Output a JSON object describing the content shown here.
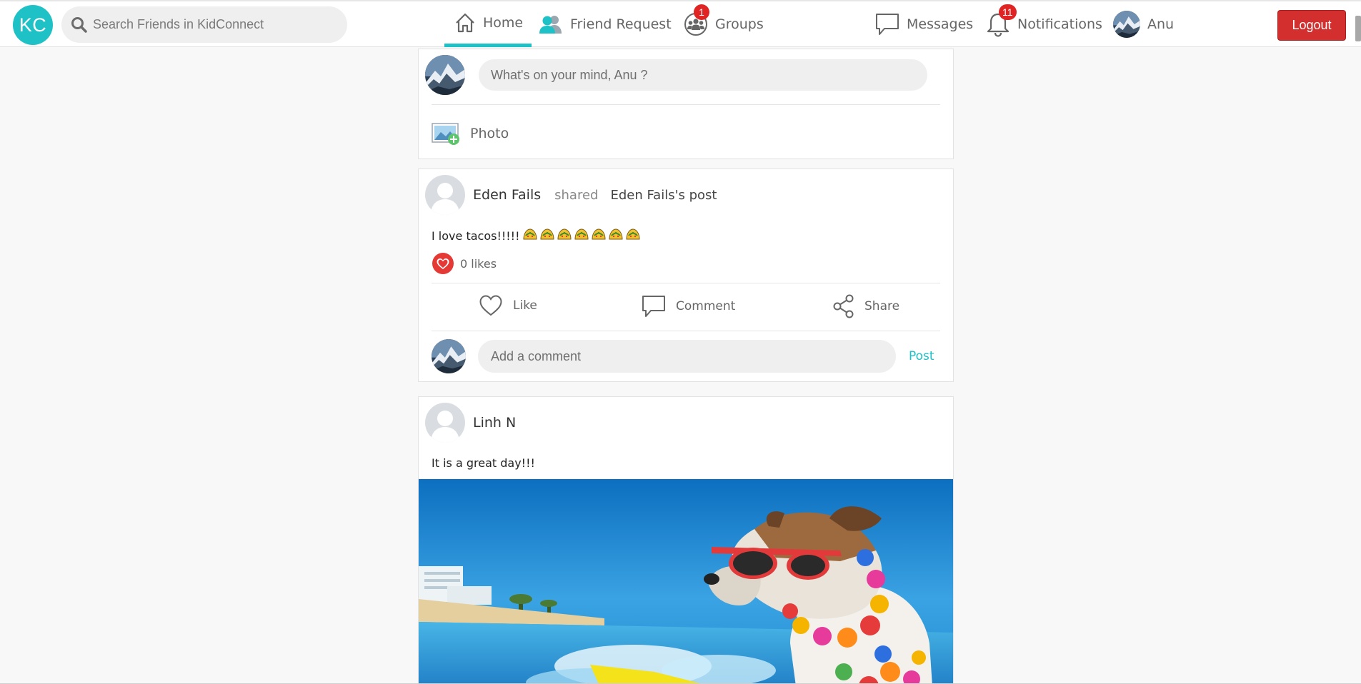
{
  "navbar": {
    "logo": "KC",
    "search_placeholder": "Search Friends in KidConnect",
    "home": "Home",
    "friend_request": "Friend Request",
    "groups": "Groups",
    "groups_badge": "1",
    "messages": "Messages",
    "notifications": "Notifications",
    "notifications_badge": "11",
    "user_name": "Anu",
    "logout": "Logout"
  },
  "composer": {
    "placeholder": "What's on your mind, Anu ?",
    "photo_label": "Photo"
  },
  "posts": [
    {
      "author": "Eden Fails",
      "action": "shared",
      "source": "Eden Fails's post",
      "text": "I love tacos!!!!!",
      "emoji_count": 7,
      "likes": "0 likes",
      "like_label": "Like",
      "comment_label": "Comment",
      "share_label": "Share",
      "comment_placeholder": "Add a comment",
      "post_label": "Post"
    },
    {
      "author": "Linh N",
      "text": "It is a great day!!!",
      "image": "dog-surfing-photo"
    }
  ],
  "colors": {
    "accent": "#1ec1c6",
    "badge": "#e02424",
    "logout": "#d32f2f",
    "heart": "#e53935"
  }
}
